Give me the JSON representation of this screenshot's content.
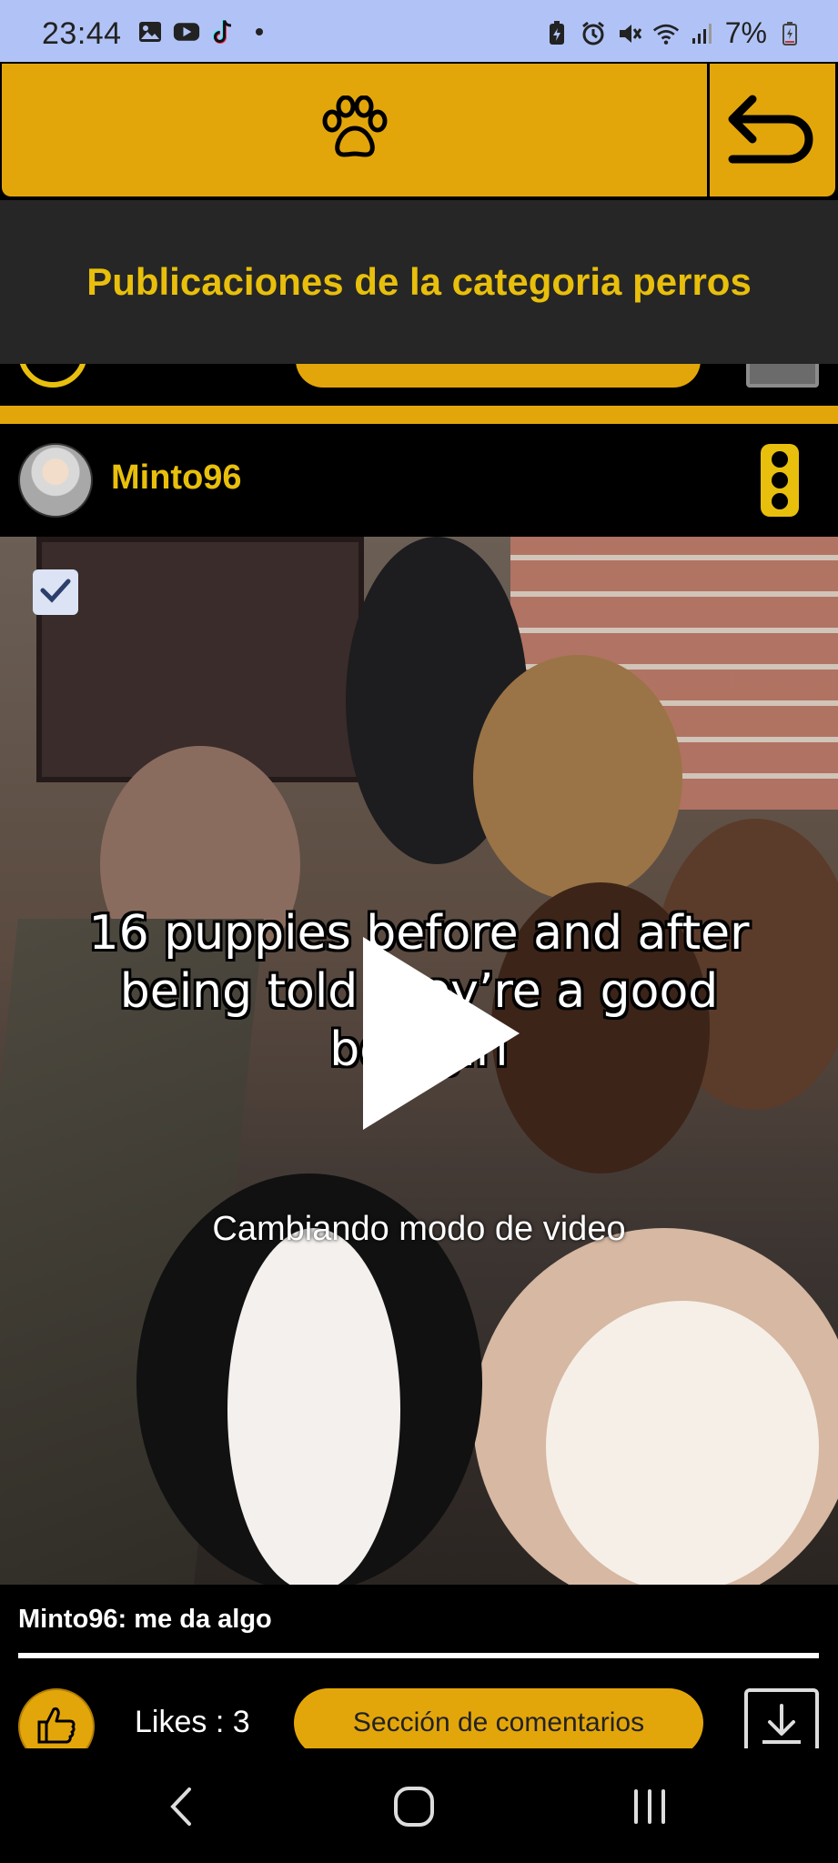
{
  "status_bar": {
    "time": "23:44",
    "battery": "7%",
    "left_icons": [
      "image-icon",
      "youtube-icon",
      "tiktok-icon",
      "dot-icon"
    ],
    "right_icons": [
      "battery-saver-icon",
      "alarm-icon",
      "mute-icon",
      "wifi-icon",
      "signal-icon",
      "battery-icon"
    ]
  },
  "top_bar": {
    "paw_icon": "paw-icon",
    "back_icon": "back-arrow-icon"
  },
  "header": {
    "title": "Publicaciones de la categoria perros"
  },
  "post": {
    "username": "Minto96",
    "video": {
      "caption": "16 puppies before and after being told they’re a good boy/girl",
      "status": "Cambiando modo de video"
    },
    "description": "Minto96: me da algo",
    "likes_label": "Likes : 3",
    "comments_label": "Sección de comentarios"
  },
  "nav_bar": {
    "buttons": [
      "back-nav-icon",
      "home-nav-icon",
      "recents-nav-icon"
    ]
  },
  "colors": {
    "accent": "#e3a60a",
    "title_yellow": "#e8bf0c",
    "status_bar_bg": "#b1c3f6",
    "header_bg": "#262626"
  }
}
